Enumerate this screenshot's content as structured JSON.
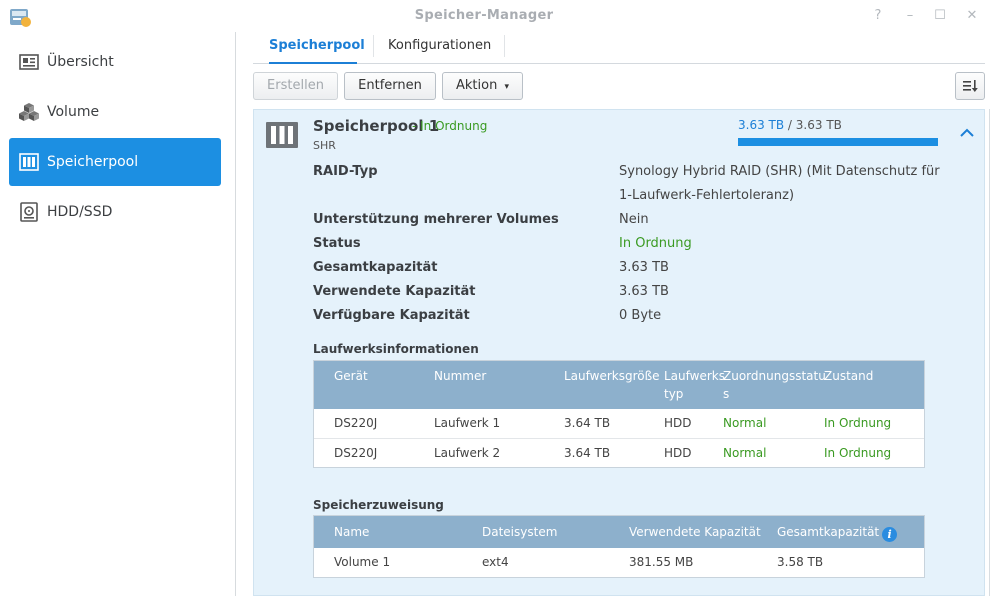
{
  "window": {
    "title": "Speicher-Manager",
    "controls": [
      "?",
      "–",
      "☐",
      "✕"
    ]
  },
  "sidebar": {
    "items": [
      {
        "label": "Übersicht",
        "icon": "overview-icon"
      },
      {
        "label": "Volume",
        "icon": "volume-cubes-icon"
      },
      {
        "label": "Speicherpool",
        "icon": "storage-pool-icon",
        "active": true
      },
      {
        "label": "HDD/SSD",
        "icon": "hdd-icon"
      }
    ]
  },
  "tabs": [
    {
      "label": "Speicherpool",
      "active": true
    },
    {
      "label": "Konfigurationen"
    }
  ],
  "toolbar": {
    "create_label": "Erstellen",
    "remove_label": "Entfernen",
    "action_label": "Aktion",
    "action_caret": "▾"
  },
  "pool": {
    "title": "Speicherpool 1",
    "status_text": "- In Ordnung",
    "type": "SHR",
    "capacity_used": "3.63 TB",
    "capacity_sep": " / ",
    "capacity_total": "3.63 TB",
    "capacity_fraction": 1.0,
    "properties": [
      {
        "label": "RAID-Typ",
        "value": "Synology Hybrid RAID (SHR) (Mit Datenschutz für",
        "value2": "1-Laufwerk-Fehlertoleranz)"
      },
      {
        "label": "Unterstützung mehrerer Volumes",
        "value": "Nein"
      },
      {
        "label": "Status",
        "value": "In Ordnung",
        "ok": true
      },
      {
        "label": "Gesamtkapazität",
        "value": "3.63 TB"
      },
      {
        "label": "Verwendete Kapazität",
        "value": "3.63 TB"
      },
      {
        "label": "Verfügbare Kapazität",
        "value": "0 Byte"
      }
    ]
  },
  "drives": {
    "title": "Laufwerksinformationen",
    "headers": {
      "device": "Gerät",
      "number": "Nummer",
      "size": "Laufwerksgröße",
      "type1": "Laufwerks",
      "type2": "typ",
      "alloc1": "Zuordnungsstatu",
      "alloc2": "s",
      "state": "Zustand"
    },
    "rows": [
      {
        "device": "DS220J",
        "number": "Laufwerk 1",
        "size": "3.64 TB",
        "type": "HDD",
        "alloc": "Normal",
        "state": "In Ordnung"
      },
      {
        "device": "DS220J",
        "number": "Laufwerk 2",
        "size": "3.64 TB",
        "type": "HDD",
        "alloc": "Normal",
        "state": "In Ordnung"
      }
    ]
  },
  "allocation": {
    "title": "Speicherzuweisung",
    "headers": {
      "name": "Name",
      "fs": "Dateisystem",
      "used": "Verwendete Kapazität",
      "total": "Gesamtkapazität",
      "info_glyph": "i"
    },
    "rows": [
      {
        "name": "Volume 1",
        "fs": "ext4",
        "used": "381.55 MB",
        "total": "3.58 TB"
      }
    ]
  },
  "colors": {
    "accent": "#1c8fe2",
    "ok": "#3a9a22",
    "panel_bg": "#e5f2fb",
    "grid_header": "#8db0cc"
  }
}
